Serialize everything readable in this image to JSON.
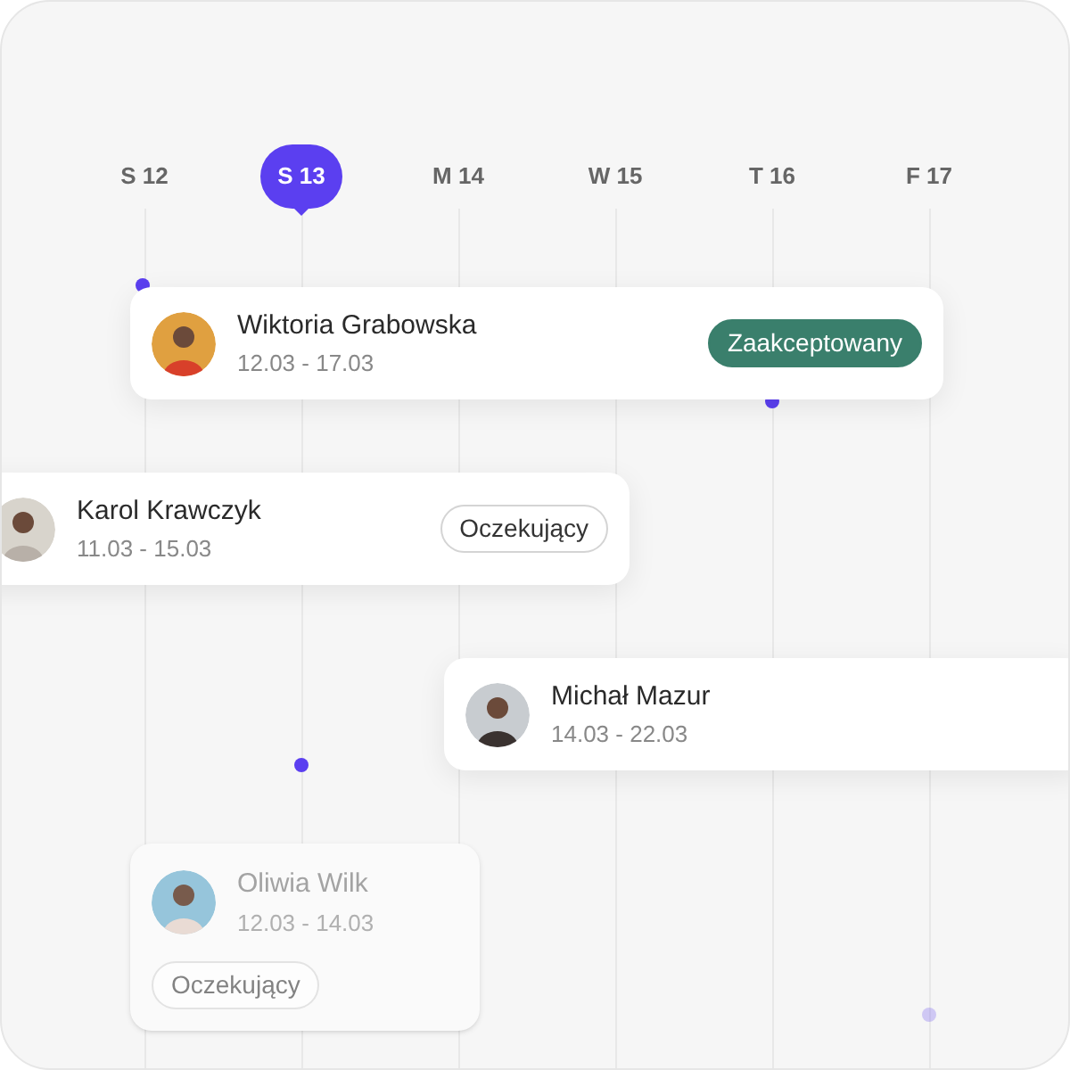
{
  "days": [
    {
      "label": "S 12",
      "selected": false
    },
    {
      "label": "S 13",
      "selected": true
    },
    {
      "label": "M 14",
      "selected": false
    },
    {
      "label": "W 15",
      "selected": false
    },
    {
      "label": "T 16",
      "selected": false
    },
    {
      "label": "F 17",
      "selected": false
    }
  ],
  "bookings": [
    {
      "name": "Wiktoria Grabowska",
      "dates": "12.03 - 17.03",
      "status": {
        "label": "Zaakceptowany",
        "kind": "accepted"
      },
      "faded": false
    },
    {
      "name": "Karol Krawczyk",
      "dates": "11.03 - 15.03",
      "status": {
        "label": "Oczekujący",
        "kind": "pending"
      },
      "faded": false
    },
    {
      "name": "Michał Mazur",
      "dates": "14.03 - 22.03",
      "faded": false
    },
    {
      "name": "Oliwia Wilk",
      "dates": "12.03 - 14.03",
      "status": {
        "label": "Oczekujący",
        "kind": "pending"
      },
      "faded": true
    }
  ]
}
